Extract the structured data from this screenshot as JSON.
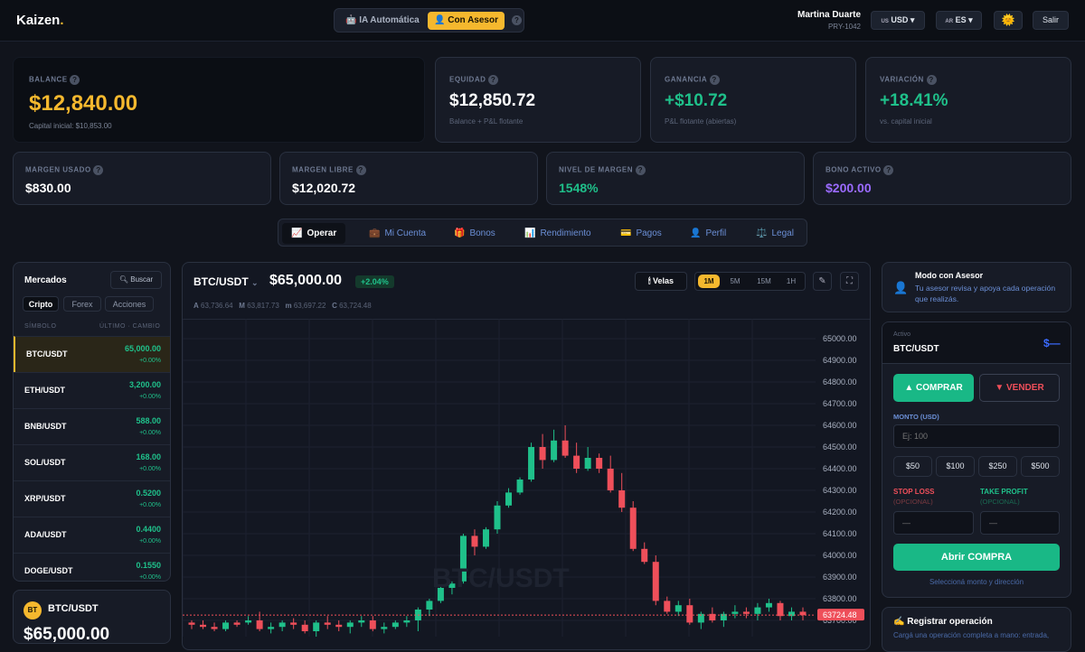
{
  "brand": {
    "name": "Kaizen",
    "dot": "."
  },
  "modes": {
    "auto": "🤖 IA Automática",
    "advisor": "👤 Con Asesor",
    "help": "?"
  },
  "user": {
    "name": "Martina Duarte",
    "id": "PRY-1042"
  },
  "currency": {
    "flag": "US",
    "label": "USD ▾"
  },
  "language": {
    "flag": "AR",
    "label": "ES ▾"
  },
  "theme_icon": "🌞",
  "logout": "Salir",
  "stats": {
    "balance": {
      "label": "BALANCE",
      "value": "$12,840.00",
      "sub": "Capital inicial: $10,853.00"
    },
    "equity": {
      "label": "EQUIDAD",
      "value": "$12,850.72",
      "sub": "Balance + P&L flotante"
    },
    "profit": {
      "label": "GANANCIA",
      "value": "+$10.72",
      "sub": "P&L flotante (abiertas)"
    },
    "variation": {
      "label": "VARIACIÓN",
      "value": "+18.41%",
      "sub": "vs. capital inicial"
    },
    "margin_used": {
      "label": "MARGEN USADO",
      "value": "$830.00"
    },
    "margin_free": {
      "label": "MARGEN LIBRE",
      "value": "$12,020.72"
    },
    "margin_level": {
      "label": "NIVEL DE MARGEN",
      "value": "1548%"
    },
    "bonus": {
      "label": "BONO ACTIVO",
      "value": "$200.00"
    }
  },
  "nav": [
    {
      "icon": "📈",
      "label": "Operar"
    },
    {
      "icon": "💼",
      "label": "Mi Cuenta"
    },
    {
      "icon": "🎁",
      "label": "Bonos"
    },
    {
      "icon": "📊",
      "label": "Rendimiento"
    },
    {
      "icon": "💳",
      "label": "Pagos"
    },
    {
      "icon": "👤",
      "label": "Perfil"
    },
    {
      "icon": "⚖️",
      "label": "Legal"
    }
  ],
  "markets": {
    "title": "Mercados",
    "search": "Buscar",
    "tabs": [
      "Cripto",
      "Forex",
      "Acciones"
    ],
    "col_symbol": "SÍMBOLO",
    "col_price": "ÚLTIMO · CAMBIO",
    "rows": [
      {
        "symbol": "BTC/USDT",
        "price": "65,000.00",
        "change": "+0.00%"
      },
      {
        "symbol": "ETH/USDT",
        "price": "3,200.00",
        "change": "+0.00%"
      },
      {
        "symbol": "BNB/USDT",
        "price": "588.00",
        "change": "+0.00%"
      },
      {
        "symbol": "SOL/USDT",
        "price": "168.00",
        "change": "+0.00%"
      },
      {
        "symbol": "XRP/USDT",
        "price": "0.5200",
        "change": "+0.00%"
      },
      {
        "symbol": "ADA/USDT",
        "price": "0.4400",
        "change": "+0.00%"
      },
      {
        "symbol": "DOGE/USDT",
        "price": "0.1550",
        "change": "+0.00%"
      }
    ]
  },
  "mini": {
    "badge": "BT",
    "symbol": "BTC/USDT",
    "price": "$65,000.00"
  },
  "chart": {
    "pair": "BTC/USDT",
    "caret": "⌄",
    "price": "$65,000.00",
    "change": "+2.04%",
    "type_label": "🕯 Velas",
    "timeframes": [
      "1M",
      "5M",
      "15M",
      "1H"
    ],
    "ohlc": {
      "o_label": "A",
      "o": "63,736.64",
      "h_label": "M",
      "h": "63,817.73",
      "l_label": "m",
      "l": "63,697.22",
      "c_label": "C",
      "c": "63,724.48"
    },
    "watermark": "BTC/USDT",
    "price_tag": "63724.48",
    "yticks": [
      "65000.00",
      "64900.00",
      "64800.00",
      "64700.00",
      "64600.00",
      "64500.00",
      "64400.00",
      "64300.00",
      "64200.00",
      "64100.00",
      "64000.00",
      "63900.00",
      "63800.00",
      "63700.00"
    ]
  },
  "chart_data": {
    "type": "candlestick",
    "ylim": [
      63700,
      65000
    ],
    "candles": [
      [
        63690,
        63700,
        63660,
        63680
      ],
      [
        63680,
        63700,
        63660,
        63670
      ],
      [
        63670,
        63690,
        63650,
        63660
      ],
      [
        63660,
        63700,
        63650,
        63690
      ],
      [
        63690,
        63700,
        63670,
        63680
      ],
      [
        63690,
        63720,
        63680,
        63700
      ],
      [
        63700,
        63740,
        63650,
        63660
      ],
      [
        63660,
        63690,
        63640,
        63670
      ],
      [
        63670,
        63700,
        63650,
        63690
      ],
      [
        63690,
        63710,
        63660,
        63680
      ],
      [
        63680,
        63700,
        63640,
        63650
      ],
      [
        63650,
        63700,
        63620,
        63690
      ],
      [
        63690,
        63720,
        63660,
        63680
      ],
      [
        63680,
        63700,
        63650,
        63670
      ],
      [
        63670,
        63700,
        63640,
        63690
      ],
      [
        63690,
        63720,
        63670,
        63700
      ],
      [
        63700,
        63720,
        63650,
        63660
      ],
      [
        63660,
        63690,
        63640,
        63670
      ],
      [
        63670,
        63700,
        63660,
        63690
      ],
      [
        63690,
        63720,
        63670,
        63700
      ],
      [
        63700,
        63760,
        63650,
        63750
      ],
      [
        63750,
        63800,
        63720,
        63790
      ],
      [
        63790,
        63860,
        63780,
        63850
      ],
      [
        63850,
        63880,
        63820,
        63870
      ],
      [
        63880,
        64100,
        63870,
        64090
      ],
      [
        64090,
        64120,
        64000,
        64040
      ],
      [
        64040,
        64130,
        64030,
        64120
      ],
      [
        64120,
        64250,
        64100,
        64230
      ],
      [
        64230,
        64310,
        64220,
        64290
      ],
      [
        64290,
        64360,
        64280,
        64350
      ],
      [
        64350,
        64520,
        64340,
        64500
      ],
      [
        64500,
        64560,
        64400,
        64440
      ],
      [
        64440,
        64580,
        64430,
        64530
      ],
      [
        64530,
        64600,
        64450,
        64460
      ],
      [
        64460,
        64520,
        64380,
        64400
      ],
      [
        64400,
        64500,
        64390,
        64450
      ],
      [
        64450,
        64470,
        64380,
        64400
      ],
      [
        64400,
        64460,
        64290,
        64300
      ],
      [
        64300,
        64380,
        64200,
        64220
      ],
      [
        64220,
        64250,
        64020,
        64030
      ],
      [
        64030,
        64060,
        63960,
        63970
      ],
      [
        63970,
        64000,
        63770,
        63790
      ],
      [
        63790,
        63810,
        63730,
        63740
      ],
      [
        63740,
        63790,
        63720,
        63770
      ],
      [
        63770,
        63800,
        63680,
        63690
      ],
      [
        63690,
        63740,
        63660,
        63730
      ],
      [
        63730,
        63760,
        63690,
        63700
      ],
      [
        63700,
        63740,
        63670,
        63730
      ],
      [
        63730,
        63770,
        63710,
        63740
      ],
      [
        63740,
        63760,
        63710,
        63730
      ],
      [
        63730,
        63780,
        63700,
        63760
      ],
      [
        63760,
        63800,
        63740,
        63780
      ],
      [
        63780,
        63790,
        63700,
        63720
      ],
      [
        63720,
        63760,
        63700,
        63740
      ],
      [
        63740,
        63760,
        63700,
        63724
      ]
    ]
  },
  "advisor": {
    "icon": "👤",
    "title": "Modo con Asesor",
    "text": "Tu asesor revisa y apoya cada operación que realizás."
  },
  "order": {
    "active_label": "Activo",
    "active": "BTC/USDT",
    "logo": "$—",
    "buy": "▲ COMPRAR",
    "sell": "▼ VENDER",
    "amount_label": "MONTO (USD)",
    "amount_placeholder": "Ej: 100",
    "quick": [
      "$50",
      "$100",
      "$250",
      "$500"
    ],
    "sl_label": "STOP LOSS",
    "sl_opt": "(OPCIONAL)",
    "tp_label": "TAKE PROFIT",
    "tp_opt": "(OPCIONAL)",
    "sl_placeholder": "—",
    "tp_placeholder": "—",
    "open": "Abrir COMPRA",
    "hint": "Seleccioná monto y dirección"
  },
  "register": {
    "title": "✍ Registrar operación",
    "text": "Cargá una operación completa a mano: entrada,"
  },
  "colors": {
    "accent": "#f5b82e",
    "green": "#1fc08a",
    "red": "#ef4f5a",
    "purple": "#9b6bff"
  }
}
